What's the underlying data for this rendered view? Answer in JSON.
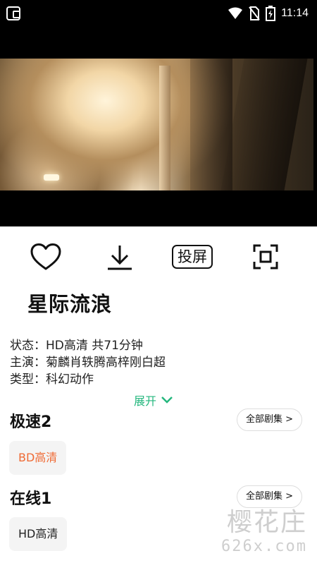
{
  "status_bar": {
    "time": "11:14",
    "icons": [
      "app-icon",
      "wifi-icon",
      "no-sim-icon",
      "battery-charging-icon"
    ]
  },
  "player": {
    "state": "video-frame"
  },
  "actions": {
    "favorite_icon": "heart-icon",
    "download_icon": "download-icon",
    "cast_label": "投屏",
    "fullscreen_icon": "fullscreen-icon"
  },
  "detail": {
    "title": "星际流浪",
    "status_line": "状态：HD高清 共71分钟",
    "cast_line": "主演：菊麟肖轶腾高梓刚白超",
    "type_line": "类型：科幻动作",
    "expand_label": "展开"
  },
  "sources": [
    {
      "name": "极速2",
      "all_label": "全部剧集 >",
      "episodes": [
        {
          "label": "BD高清",
          "active": true
        }
      ]
    },
    {
      "name": "在线1",
      "all_label": "全部剧集 >",
      "episodes": [
        {
          "label": "HD高清",
          "active": false
        }
      ]
    }
  ],
  "watermark": {
    "text": "樱花庄",
    "url": "626x.com"
  },
  "colors": {
    "accent_green": "#25b77e",
    "active_episode": "#ef6a34",
    "chip_bg": "#f4f4f4"
  }
}
